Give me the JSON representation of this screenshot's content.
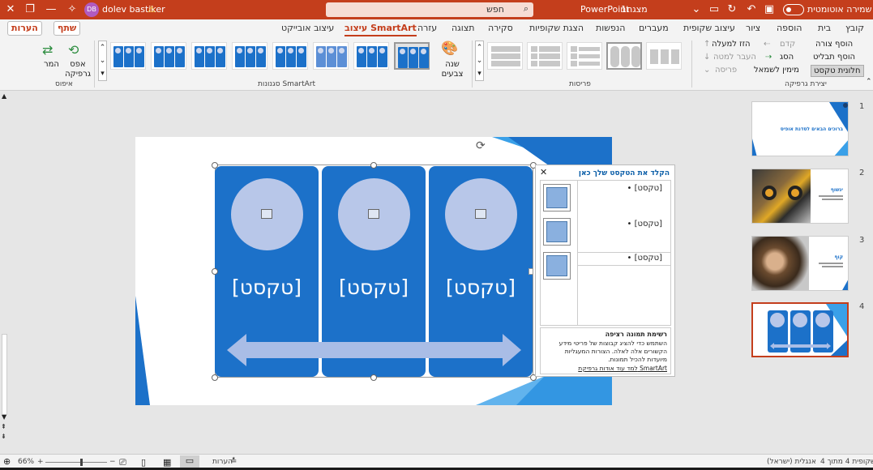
{
  "titlebar": {
    "doc_title": "מצגת1",
    "app": "PowerPoint",
    "search_placeholder": "חפש",
    "user": "dolev bastiker",
    "initials": "DB",
    "autosave": "שמירה אוטומטית",
    "warning": "⚠"
  },
  "tabs": [
    "קובץ",
    "בית",
    "הוספה",
    "ציור",
    "עיצוב שקופית",
    "מעברים",
    "הנפשות",
    "הצגת שקופיות",
    "סקירה",
    "תצוגה",
    "עזרה"
  ],
  "active_tab": "עיצוב SmartArt",
  "format_tab": "עיצוב אובייקט",
  "share": "שתף",
  "comments": "הערות",
  "ribbon": {
    "create_graphic": {
      "label": "יצירת גרפיקה",
      "add_shape": "הוסף צורה",
      "add_bullet": "הוסף תבליט",
      "text_pane": "חלונית טקסט",
      "promote": "קדם",
      "demote": "הסג",
      "move_up": "הזז למעלה",
      "move_down": "העבר למטה",
      "rtl": "מימין לשמאל",
      "layout": "פריסה"
    },
    "layouts_label": "פריסות",
    "styles_label": "סגנונות SmartArt",
    "change_colors": "שנה צבעים",
    "reset_label": "איפוס",
    "reset_graphic": "אפס גרפיקה",
    "convert": "המר"
  },
  "smartart": {
    "card_texts": [
      "[טקסט]",
      "[טקסט]",
      "[טקסט]"
    ]
  },
  "textpane": {
    "header": "הקלד את הטקסט שלך כאן",
    "bullets": [
      "[טקסט]",
      "[טקסט]",
      "[טקסט]"
    ],
    "desc_title": "רשימת תמונה רציפה",
    "desc_body": "השתמש כדי להציג קבוצות של פריטי מידע הקשורים אלה לאלה. הצורות המעגליות מיועדות להכיל תמונות.",
    "link": "למד עוד אודות גרפיקת SmartArt"
  },
  "thumbs": {
    "numbers": [
      "1",
      "2",
      "3",
      "4"
    ],
    "slide1_title": "ברוכים הבאים לסדנת אופיס",
    "slide2_title": "ינשוף",
    "slide3_title": "קוף"
  },
  "status": {
    "slide_of": "שקופית 4 מתוך 4",
    "language": "אנגלית (ישראל)",
    "notes": "הערות",
    "zoom": "66%"
  }
}
